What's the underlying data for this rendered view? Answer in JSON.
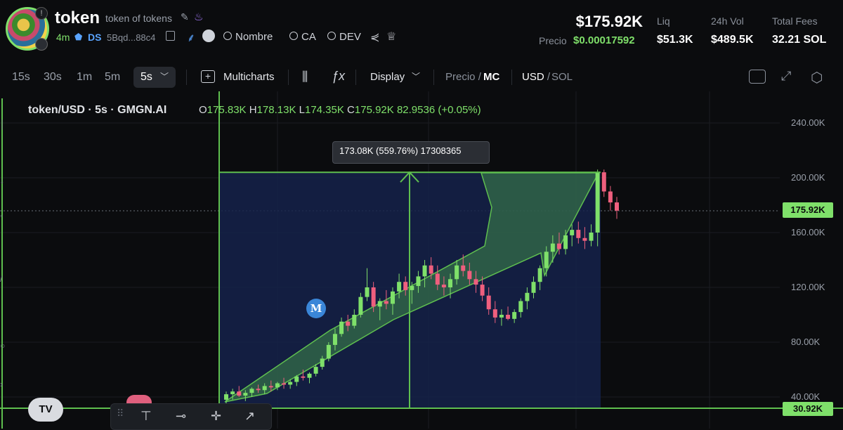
{
  "header": {
    "token_name": "token",
    "token_fullname": "token of tokens",
    "age": "4m",
    "ds_label": "DS",
    "address": "5Bqd...88c4",
    "search_links": [
      "Nombre",
      "CA",
      "DEV"
    ],
    "market_cap": "$175.92K",
    "precio_label": "Precio",
    "precio_value": "$0.00017592",
    "stats": [
      {
        "label": "Liq",
        "value": "$51.3K"
      },
      {
        "label": "24h Vol",
        "value": "$489.5K"
      },
      {
        "label": "Total Fees",
        "value": "32.21 SOL"
      }
    ]
  },
  "toolbar": {
    "timeframes": [
      "15s",
      "30s",
      "1m",
      "5m"
    ],
    "active_timeframe": "5s",
    "multicharts": "Multicharts",
    "display": "Display",
    "precio_toggle": "Precio",
    "mc_toggle": "MC",
    "usd_toggle": "USD",
    "sol_toggle": "SOL",
    "separator": "/"
  },
  "chart": {
    "pair_title": "token/USD · 5s · GMGN.AI",
    "ohlc": {
      "o_label": "O",
      "o": "175.83K",
      "h_label": "H",
      "h": "178.13K",
      "l_label": "L",
      "l": "174.35K",
      "c_label": "C",
      "c": "175.92K",
      "extra": "82.9536 (+0.05%)"
    },
    "measure_tooltip": "173.08K (559.76%) 17308365",
    "last_price_tag": "175.92K",
    "low_tag": "30.92K",
    "y_ticks": [
      "240.00K",
      "200.00K",
      "160.00K",
      "120.00K",
      "80.00K",
      "40.00K"
    ],
    "marker_letter": "M",
    "tv_logo": "TV",
    "colors": {
      "up": "#7fe06a",
      "down": "#ef5f7e",
      "measure_fill": "#15224a",
      "measure_line": "#5fbf4f",
      "arrow_fill": "#3f8a4a"
    }
  },
  "chart_data": {
    "type": "candlestick",
    "title": "token/USD · 5s · GMGN.AI",
    "ylim": [
      20,
      260
    ],
    "y_ticks": [
      40,
      80,
      120,
      160,
      200,
      240
    ],
    "last_price": 175.92,
    "measure": {
      "from": 30.92,
      "to": 204.0,
      "change": "173.08K (559.76%)"
    },
    "candles": [
      {
        "o": 38,
        "h": 44,
        "l": 34,
        "c": 42
      },
      {
        "o": 42,
        "h": 46,
        "l": 38,
        "c": 44
      },
      {
        "o": 44,
        "h": 48,
        "l": 40,
        "c": 41
      },
      {
        "o": 41,
        "h": 45,
        "l": 37,
        "c": 43
      },
      {
        "o": 43,
        "h": 47,
        "l": 40,
        "c": 46
      },
      {
        "o": 46,
        "h": 49,
        "l": 43,
        "c": 45
      },
      {
        "o": 45,
        "h": 50,
        "l": 42,
        "c": 48
      },
      {
        "o": 48,
        "h": 52,
        "l": 44,
        "c": 47
      },
      {
        "o": 47,
        "h": 51,
        "l": 45,
        "c": 50
      },
      {
        "o": 50,
        "h": 54,
        "l": 46,
        "c": 49
      },
      {
        "o": 49,
        "h": 53,
        "l": 46,
        "c": 51
      },
      {
        "o": 51,
        "h": 56,
        "l": 48,
        "c": 55
      },
      {
        "o": 55,
        "h": 60,
        "l": 52,
        "c": 54
      },
      {
        "o": 54,
        "h": 58,
        "l": 50,
        "c": 57
      },
      {
        "o": 57,
        "h": 64,
        "l": 55,
        "c": 62
      },
      {
        "o": 62,
        "h": 70,
        "l": 60,
        "c": 68
      },
      {
        "o": 68,
        "h": 80,
        "l": 66,
        "c": 78
      },
      {
        "o": 78,
        "h": 90,
        "l": 74,
        "c": 86
      },
      {
        "o": 86,
        "h": 98,
        "l": 84,
        "c": 95
      },
      {
        "o": 95,
        "h": 100,
        "l": 88,
        "c": 92
      },
      {
        "o": 92,
        "h": 104,
        "l": 90,
        "c": 100
      },
      {
        "o": 100,
        "h": 116,
        "l": 98,
        "c": 113
      },
      {
        "o": 113,
        "h": 134,
        "l": 110,
        "c": 120
      },
      {
        "o": 120,
        "h": 124,
        "l": 102,
        "c": 106
      },
      {
        "o": 106,
        "h": 112,
        "l": 96,
        "c": 110
      },
      {
        "o": 110,
        "h": 118,
        "l": 104,
        "c": 108
      },
      {
        "o": 108,
        "h": 120,
        "l": 100,
        "c": 117
      },
      {
        "o": 117,
        "h": 130,
        "l": 112,
        "c": 124
      },
      {
        "o": 124,
        "h": 128,
        "l": 114,
        "c": 118
      },
      {
        "o": 118,
        "h": 124,
        "l": 108,
        "c": 121
      },
      {
        "o": 121,
        "h": 132,
        "l": 116,
        "c": 128
      },
      {
        "o": 128,
        "h": 140,
        "l": 120,
        "c": 136
      },
      {
        "o": 136,
        "h": 142,
        "l": 126,
        "c": 130
      },
      {
        "o": 130,
        "h": 136,
        "l": 118,
        "c": 122
      },
      {
        "o": 122,
        "h": 128,
        "l": 114,
        "c": 120
      },
      {
        "o": 120,
        "h": 130,
        "l": 112,
        "c": 126
      },
      {
        "o": 126,
        "h": 140,
        "l": 122,
        "c": 136
      },
      {
        "o": 136,
        "h": 144,
        "l": 128,
        "c": 132
      },
      {
        "o": 132,
        "h": 138,
        "l": 122,
        "c": 126
      },
      {
        "o": 126,
        "h": 132,
        "l": 116,
        "c": 122
      },
      {
        "o": 122,
        "h": 128,
        "l": 110,
        "c": 114
      },
      {
        "o": 114,
        "h": 120,
        "l": 100,
        "c": 104
      },
      {
        "o": 104,
        "h": 110,
        "l": 94,
        "c": 98
      },
      {
        "o": 98,
        "h": 104,
        "l": 92,
        "c": 100
      },
      {
        "o": 100,
        "h": 106,
        "l": 96,
        "c": 97
      },
      {
        "o": 97,
        "h": 104,
        "l": 94,
        "c": 102
      },
      {
        "o": 102,
        "h": 112,
        "l": 98,
        "c": 110
      },
      {
        "o": 110,
        "h": 120,
        "l": 104,
        "c": 116
      },
      {
        "o": 116,
        "h": 128,
        "l": 112,
        "c": 124
      },
      {
        "o": 124,
        "h": 136,
        "l": 118,
        "c": 134
      },
      {
        "o": 134,
        "h": 150,
        "l": 128,
        "c": 146
      },
      {
        "o": 146,
        "h": 158,
        "l": 138,
        "c": 152
      },
      {
        "o": 152,
        "h": 160,
        "l": 144,
        "c": 148
      },
      {
        "o": 148,
        "h": 162,
        "l": 144,
        "c": 158
      },
      {
        "o": 158,
        "h": 166,
        "l": 150,
        "c": 162
      },
      {
        "o": 162,
        "h": 168,
        "l": 152,
        "c": 156
      },
      {
        "o": 156,
        "h": 164,
        "l": 148,
        "c": 154
      },
      {
        "o": 154,
        "h": 166,
        "l": 150,
        "c": 160
      },
      {
        "o": 160,
        "h": 206,
        "l": 150,
        "c": 204
      },
      {
        "o": 204,
        "h": 206,
        "l": 186,
        "c": 190
      },
      {
        "o": 190,
        "h": 194,
        "l": 176,
        "c": 182
      },
      {
        "o": 182,
        "h": 186,
        "l": 170,
        "c": 176
      }
    ]
  }
}
